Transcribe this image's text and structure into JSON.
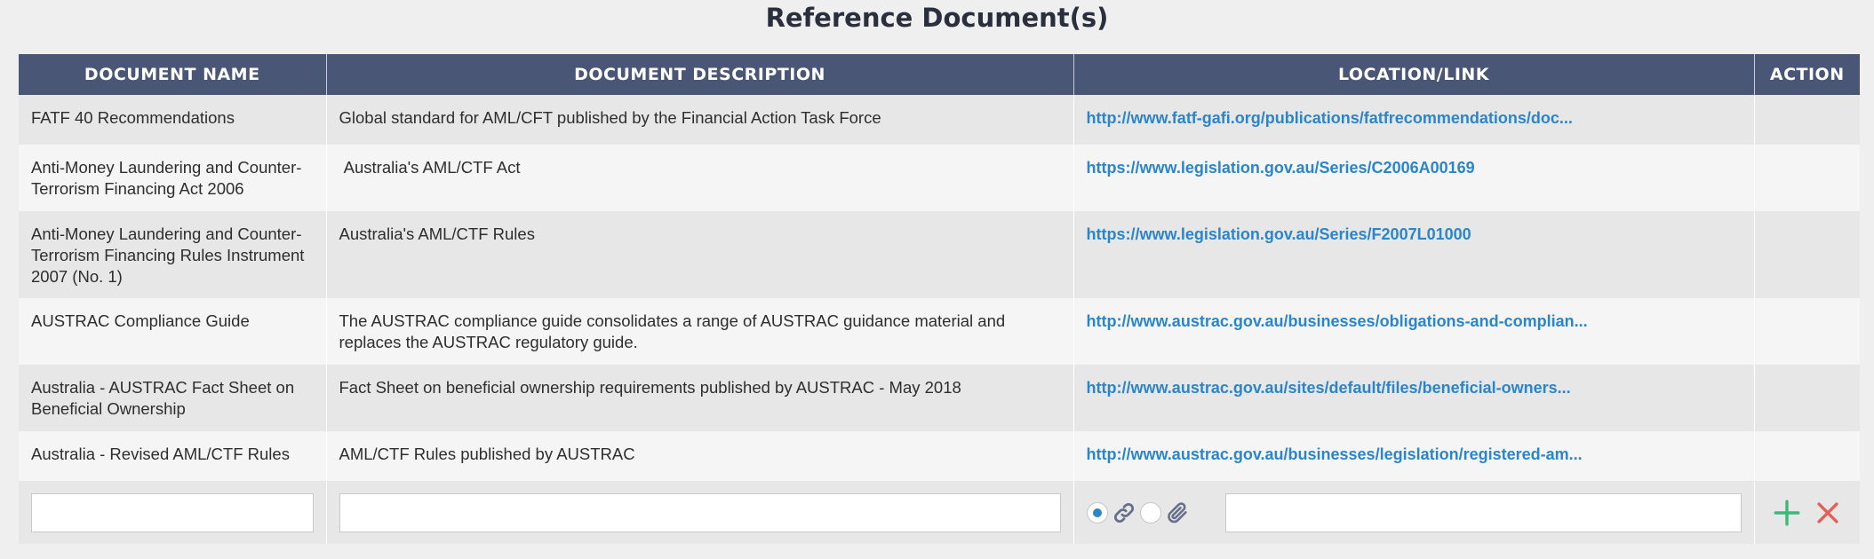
{
  "page": {
    "title": "Reference Document(s)"
  },
  "table": {
    "headers": {
      "name": "DOCUMENT NAME",
      "description": "DOCUMENT DESCRIPTION",
      "location": "LOCATION/LINK",
      "action": "ACTION"
    },
    "rows": [
      {
        "name": "FATF 40 Recommendations",
        "description": "Global standard for AML/CFT published by the Financial Action Task Force",
        "link": "http://www.fatf-gafi.org/publications/fatfrecommendations/doc..."
      },
      {
        "name": "Anti-Money Laundering and Counter-Terrorism Financing Act 2006",
        "description": " Australia's AML/CTF Act",
        "link": "https://www.legislation.gov.au/Series/C2006A00169"
      },
      {
        "name": "Anti-Money Laundering and Counter-Terrorism Financing Rules Instrument 2007 (No. 1)",
        "description": "Australia's AML/CTF Rules",
        "link": "https://www.legislation.gov.au/Series/F2007L01000"
      },
      {
        "name": "AUSTRAC Compliance Guide",
        "description": "The AUSTRAC compliance guide consolidates a range of AUSTRAC guidance material and replaces the AUSTRAC regulatory guide.",
        "link": "http://www.austrac.gov.au/businesses/obligations-and-complian..."
      },
      {
        "name": "Australia - AUSTRAC Fact Sheet on Beneficial Ownership",
        "description": "Fact Sheet on beneficial ownership requirements published by AUSTRAC - May 2018",
        "link": "http://www.austrac.gov.au/sites/default/files/beneficial-owners..."
      },
      {
        "name": "Australia - Revised AML/CTF Rules",
        "description": "AML/CTF Rules published by AUSTRAC",
        "link": "http://www.austrac.gov.au/businesses/legislation/registered-am..."
      }
    ]
  },
  "new_entry": {
    "name_value": "",
    "description_value": "",
    "location_value": "",
    "location_mode_selected": "link",
    "icons": {
      "link_mode": "chain-link-icon",
      "file_mode": "paperclip-icon",
      "add": "plus-icon",
      "cancel": "x-icon"
    }
  },
  "colors": {
    "header_bg": "#495675",
    "link": "#2a86c8",
    "add": "#3cb878",
    "cancel": "#e0605a"
  }
}
